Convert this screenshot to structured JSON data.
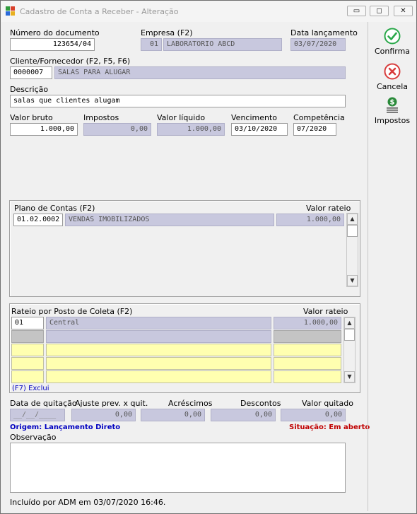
{
  "window": {
    "title": "Cadastro de Conta a Receber - Alteração",
    "minimize_glyph": "▭",
    "maximize_glyph": "◻",
    "close_glyph": "✕"
  },
  "header": {
    "numero_label": "Número do documento",
    "numero_value": "123654/04",
    "empresa_label": "Empresa (F2)",
    "empresa_code": "01",
    "empresa_name": "LABORATORIO ABCD",
    "data_lanc_label": "Data lançamento",
    "data_lanc_value": "03/07/2020",
    "cliente_label": "Cliente/Fornecedor (F2, F5, F6)",
    "cliente_code": "0000007",
    "cliente_name": "SALAS PARA ALUGAR",
    "descricao_label": "Descrição",
    "descricao_value": "salas que clientes alugam"
  },
  "values": {
    "valor_bruto_label": "Valor bruto",
    "valor_bruto": "1.000,00",
    "impostos_label": "Impostos",
    "impostos": "0,00",
    "valor_liquido_label": "Valor líquido",
    "valor_liquido": "1.000,00",
    "vencimento_label": "Vencimento",
    "vencimento": "03/10/2020",
    "competencia_label": "Competência",
    "competencia": "07/2020"
  },
  "plano": {
    "label": "Plano de Contas (F2)",
    "rateio_label": "Valor rateio",
    "rows": [
      {
        "code": "01.02.0002",
        "name": "VENDAS IMOBILIZADOS",
        "value": "1.000,00"
      }
    ]
  },
  "rateio": {
    "label": "Rateio por Posto de Coleta (F2)",
    "rateio_label": "Valor rateio",
    "rows": [
      {
        "code": "01",
        "name": "Central",
        "value": "1.000,00"
      }
    ],
    "f7_label": "(F7) Exclui"
  },
  "quitacao": {
    "data_label": "Data de quitação",
    "data_value": "__/__/____",
    "ajuste_label": "Ajuste prev. x quit.",
    "ajuste_value": "0,00",
    "acrescimos_label": "Acréscimos",
    "acrescimos_value": "0,00",
    "descontos_label": "Descontos",
    "descontos_value": "0,00",
    "valor_quitado_label": "Valor quitado",
    "valor_quitado_value": "0,00"
  },
  "status": {
    "origem": "Origem: Lançamento Direto",
    "situacao": "Situação: Em aberto"
  },
  "observacao": {
    "label": "Observação",
    "value": ""
  },
  "footer": {
    "incluido": "Incluído por ADM em 03/07/2020 16:46."
  },
  "sidebar": {
    "confirma": "Confirma",
    "cancela": "Cancela",
    "impostos": "Impostos"
  },
  "colors": {
    "readonly_bg": "#c8c8de",
    "empty_row_bg": "#ffffb0",
    "confirm_green": "#2aa84a",
    "cancel_red": "#d83c3c",
    "origem_blue": "#0000c0",
    "situacao_red": "#c00000"
  },
  "icons": {
    "confirma": "check-circle-icon",
    "cancela": "x-circle-icon",
    "impostos": "dollar-coins-icon"
  }
}
